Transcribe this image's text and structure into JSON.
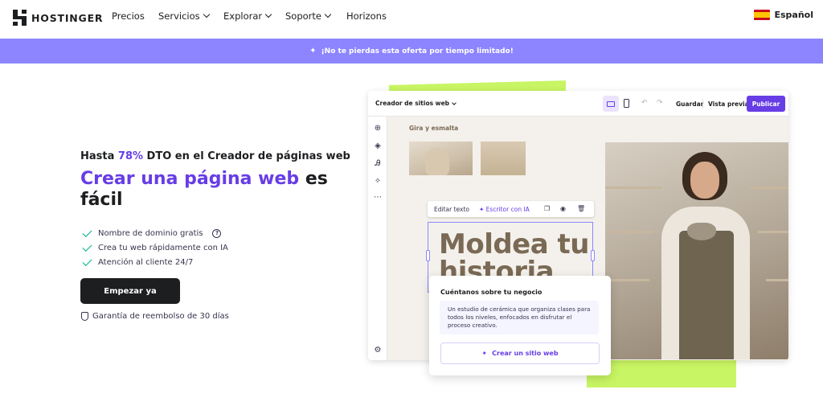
{
  "nav": {
    "brand": "HOSTINGER",
    "items": [
      {
        "label": "Precios",
        "dropdown": false
      },
      {
        "label": "Servicios",
        "dropdown": true
      },
      {
        "label": "Explorar",
        "dropdown": true
      },
      {
        "label": "Soporte",
        "dropdown": true
      },
      {
        "label": "Horizons",
        "dropdown": false
      }
    ],
    "language": "Español"
  },
  "promo": {
    "text": "¡No te pierdas esta oferta por tiempo limitado!"
  },
  "hero": {
    "sub_prefix": "Hasta ",
    "sub_highlight": "78%",
    "sub_suffix": " DTO en el Creador de páginas web",
    "title_highlight": "Crear una página web",
    "title_rest": " es fácil",
    "features": [
      "Nombre de dominio gratis",
      "Crea tu web rápidamente con IA",
      "Atención al cliente 24/7"
    ],
    "cta": "Empezar ya",
    "guarantee": "Garantía de reembolso de 30 días"
  },
  "editor": {
    "selector": "Creador de sitios web",
    "save": "Guardar",
    "preview": "Vista previa",
    "publish": "Publicar",
    "brand_name": "Gira y esmalta",
    "tools": {
      "edit_text": "Editar texto",
      "ai_writer": "Escritor con IA"
    },
    "headline_line1": "Moldea tu",
    "headline_line2": "historia"
  },
  "card": {
    "title": "Cuéntanos sobre tu negocio",
    "text": "Un estudio de cerámica que organiza clases para todos los niveles, enfocados en disfrutar el proceso creativo.",
    "button": "Crear un sitio web"
  },
  "colors": {
    "accent": "#673de6",
    "promo_bg": "#8c85ff",
    "lime": "#c8f563",
    "check": "#00b090"
  }
}
